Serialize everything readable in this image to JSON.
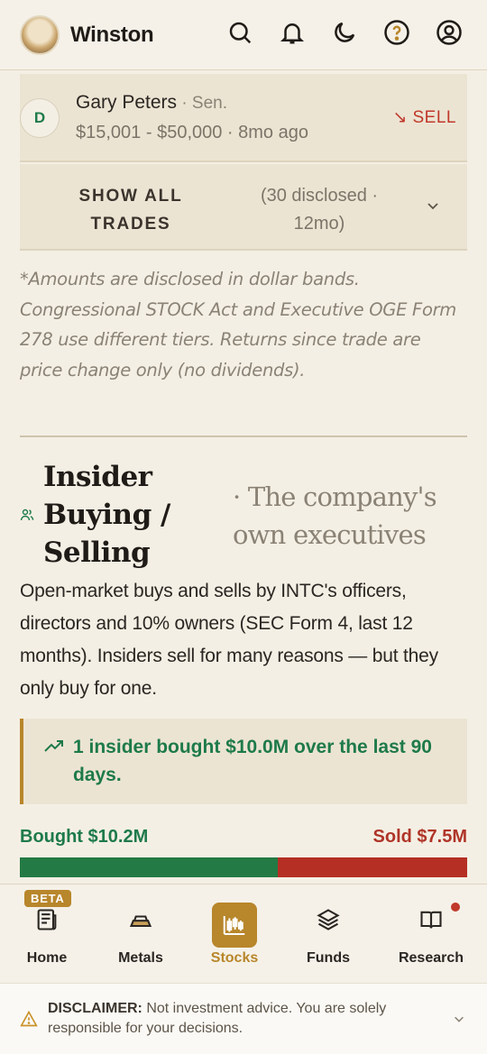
{
  "header": {
    "brand": "Winston",
    "icons": [
      "search-icon",
      "bell-icon",
      "moon-icon",
      "help-icon",
      "account-icon"
    ]
  },
  "trade": {
    "badge": "D",
    "name": "Gary Peters",
    "role": " · Sen.",
    "amount": "$15,001 - $50,000 · 8mo ago",
    "action": "↘ SELL"
  },
  "show_all": {
    "label": "SHOW ALL TRADES",
    "count": "(30 disclosed · 12mo)"
  },
  "note": "*Amounts are disclosed in dollar bands. Congressional STOCK Act and Executive OGE Form 278 use different tiers. Returns since trade are price change only (no dividends).",
  "insiders": {
    "title": "Insider Buying / Selling",
    "subtitle": "· The company's own executives",
    "description": "Open-market buys and sells by INTC's officers, directors and 10% owners (SEC Form 4, last 12 months). Insiders sell for many reasons — but they only buy for one.",
    "callout": "1 insider bought $10.0M over the last 90 days.",
    "bought_label": "Bought $10.2M",
    "sold_label": "Sold $7.5M",
    "bought_value": 10.2,
    "sold_value": 7.5,
    "colors": {
      "bought": "#237a44",
      "sold": "#b52f24"
    }
  },
  "nav": {
    "beta": "BETA",
    "items": [
      {
        "label": "Home",
        "icon": "newspaper-icon"
      },
      {
        "label": "Metals",
        "icon": "gold-bars-icon"
      },
      {
        "label": "Stocks",
        "icon": "candlestick-icon"
      },
      {
        "label": "Funds",
        "icon": "layers-icon"
      },
      {
        "label": "Research",
        "icon": "book-icon"
      }
    ],
    "active": "Stocks"
  },
  "disclaimer": {
    "label": "DISCLAIMER:",
    "text": " Not investment advice. You are solely responsible for your decisions."
  },
  "accent": "#b8862b"
}
